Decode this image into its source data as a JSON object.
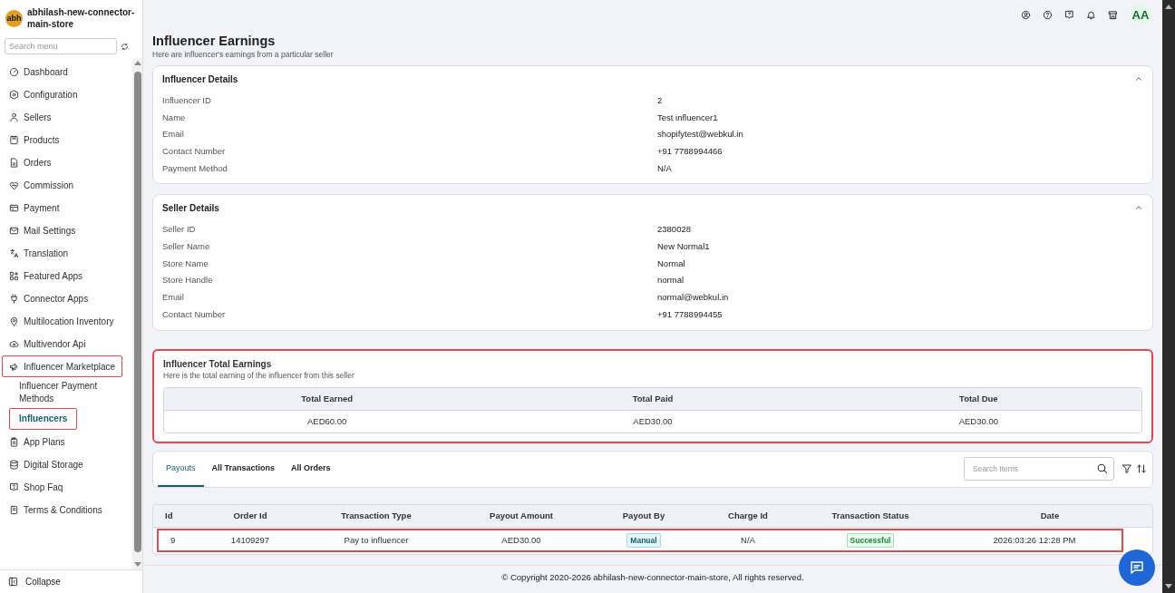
{
  "sidebar": {
    "store_avatar": "abh",
    "store_name": "abhilash-new-connector-main-store",
    "search": {
      "placeholder": "Search menu"
    },
    "items": [
      {
        "label": "Dashboard",
        "selected": false,
        "highlighted": false
      },
      {
        "label": "Configuration",
        "selected": false,
        "highlighted": false
      },
      {
        "label": "Sellers",
        "selected": false,
        "highlighted": false
      },
      {
        "label": "Products",
        "selected": false,
        "highlighted": false
      },
      {
        "label": "Orders",
        "selected": false,
        "highlighted": false
      },
      {
        "label": "Commission",
        "selected": false,
        "highlighted": false
      },
      {
        "label": "Payment",
        "selected": false,
        "highlighted": false
      },
      {
        "label": "Mail Settings",
        "selected": false,
        "highlighted": false
      },
      {
        "label": "Translation",
        "selected": false,
        "highlighted": false
      },
      {
        "label": "Featured Apps",
        "selected": false,
        "highlighted": false
      },
      {
        "label": "Connector Apps",
        "selected": false,
        "highlighted": false
      },
      {
        "label": "Multilocation Inventory",
        "selected": false,
        "highlighted": false
      },
      {
        "label": "Multivendor Api",
        "selected": false,
        "highlighted": false
      },
      {
        "label": "Influencer Marketplace",
        "selected": false,
        "highlighted": true,
        "children": [
          {
            "label": "Influencer Payment Methods",
            "selected": false,
            "highlighted": false
          },
          {
            "label": "Influencers",
            "selected": true,
            "highlighted": true
          }
        ]
      },
      {
        "label": "App Plans",
        "selected": false,
        "highlighted": false
      },
      {
        "label": "Digital Storage",
        "selected": false,
        "highlighted": false
      },
      {
        "label": "Shop Faq",
        "selected": false,
        "highlighted": false
      },
      {
        "label": "Terms & Conditions",
        "selected": false,
        "highlighted": false
      }
    ],
    "collapse": "Collapse"
  },
  "header": {
    "avatar": "AA"
  },
  "page": {
    "title": "Influencer Earnings",
    "subtitle": "Here are influencer's earnings from a particular seller"
  },
  "influencer_details": {
    "title": "Influencer Details",
    "expanded": true,
    "fields": [
      {
        "label": "Influencer ID",
        "value": "2"
      },
      {
        "label": "Name",
        "value": "Test influencer1"
      },
      {
        "label": "Email",
        "value": "shopifytest@webkul.in"
      },
      {
        "label": "Contact Number",
        "value": "+91 7788994466"
      },
      {
        "label": "Payment Method",
        "value": "N/A"
      }
    ]
  },
  "seller_details": {
    "title": "Seller Details",
    "expanded": true,
    "fields": [
      {
        "label": "Seller ID",
        "value": "2380028"
      },
      {
        "label": "Seller Name",
        "value": "New Normal1"
      },
      {
        "label": "Store Name",
        "value": "Normal"
      },
      {
        "label": "Store Handle",
        "value": "normal"
      },
      {
        "label": "Email",
        "value": "normal@webkul.in"
      },
      {
        "label": "Contact Number",
        "value": "+91 7788994455"
      }
    ]
  },
  "total_earnings": {
    "title": "Influencer Total Earnings",
    "subtitle": "Here is the total earning of the influencer from this seller",
    "highlighted": true,
    "columns": [
      "Total Earned",
      "Total Paid",
      "Total Due"
    ],
    "values": [
      "AED60.00",
      "AED30.00",
      "AED30.00"
    ]
  },
  "transactions": {
    "tabs": [
      {
        "label": "Payouts",
        "selected": true
      },
      {
        "label": "All Transactions",
        "selected": false
      },
      {
        "label": "All Orders",
        "selected": false
      }
    ],
    "search": {
      "placeholder": "Search Items"
    },
    "table": {
      "columns": [
        "Id",
        "Order Id",
        "Transaction Type",
        "Payout Amount",
        "Payout By",
        "Charge Id",
        "Transaction Status",
        "Date"
      ],
      "rows": [
        {
          "highlighted": true,
          "cells": [
            {
              "text": "9",
              "kind": "text"
            },
            {
              "text": "14109297",
              "kind": "text"
            },
            {
              "text": "Pay to influencer",
              "kind": "text"
            },
            {
              "text": "AED30.00",
              "kind": "text"
            },
            {
              "text": "Manual",
              "kind": "info-badge"
            },
            {
              "text": "N/A",
              "kind": "text"
            },
            {
              "text": "Successful",
              "kind": "success-badge"
            },
            {
              "text": "2026:03:26 12:28 PM",
              "kind": "text"
            }
          ]
        }
      ]
    }
  },
  "footer": {
    "copyright": "© Copyright 2020-2026 abhilash-new-connector-main-store, All rights reserved."
  }
}
